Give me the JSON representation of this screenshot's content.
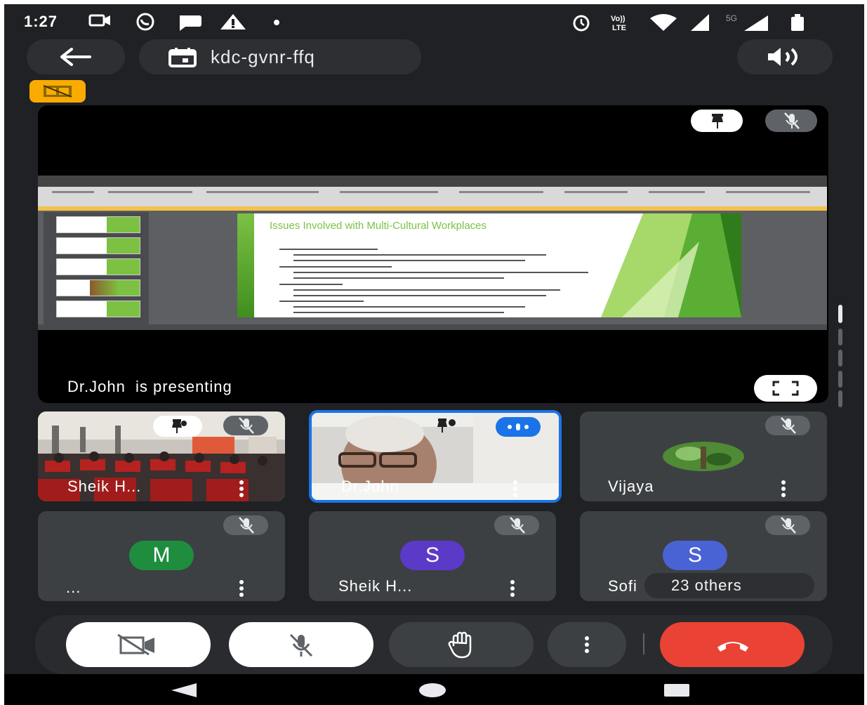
{
  "status_bar": {
    "time": "1:27",
    "left_icons": [
      "video-camera-icon",
      "whatsapp-icon",
      "chat-bubble-icon",
      "warning-icon",
      "dot-icon"
    ],
    "right_icons": [
      "alarm-icon",
      "volte-icon",
      "wifi-icon",
      "signal-icon",
      "5g-signal-icon",
      "battery-icon"
    ]
  },
  "top_bar": {
    "meeting_code": "kdc-gvnr-ffq",
    "back_icon": "arrow-left-icon",
    "calendar_icon": "calendar-icon",
    "speaker_icon": "speaker-icon"
  },
  "recording_badge_icon": "recording-off-icon",
  "presentation": {
    "presenting_text": "Dr.John  is presenting",
    "slide_title": "Issues Involved with Multi-Cultural Workplaces",
    "pin_icon": "pin-icon",
    "mic_icon": "mic-off-icon",
    "fullscreen_icon": "fullscreen-icon"
  },
  "participants": [
    {
      "name": "Sheik H...",
      "type": "video",
      "mic": "mic-off"
    },
    {
      "name": "Dr.John",
      "type": "video",
      "mic": "speaking",
      "active": true
    },
    {
      "name": "Vijaya",
      "type": "photo",
      "mic": "mic-off"
    },
    {
      "name": "...",
      "type": "avatar",
      "initial": "M",
      "color": "#1e8e3e",
      "mic": "mic-off"
    },
    {
      "name": "Sheik H...",
      "type": "avatar",
      "initial": "S",
      "color": "#5b3ac7",
      "mic": "mic-off"
    },
    {
      "name": "Sofi",
      "type": "avatar",
      "initial": "S",
      "color": "#4a63d4",
      "mic": "mic-off",
      "overlay": "23 others"
    }
  ],
  "controls": [
    "camera-off-icon",
    "mic-off-icon",
    "raise-hand-icon",
    "more-options-icon",
    "end-call-icon"
  ],
  "nav": [
    "back-nav-icon",
    "home-nav-icon",
    "recents-nav-icon"
  ],
  "colors": {
    "background": "#202124",
    "tile": "#3c4043",
    "end_call": "#ea4335",
    "active_border": "#1a73e8",
    "recording": "#f9ab00"
  }
}
